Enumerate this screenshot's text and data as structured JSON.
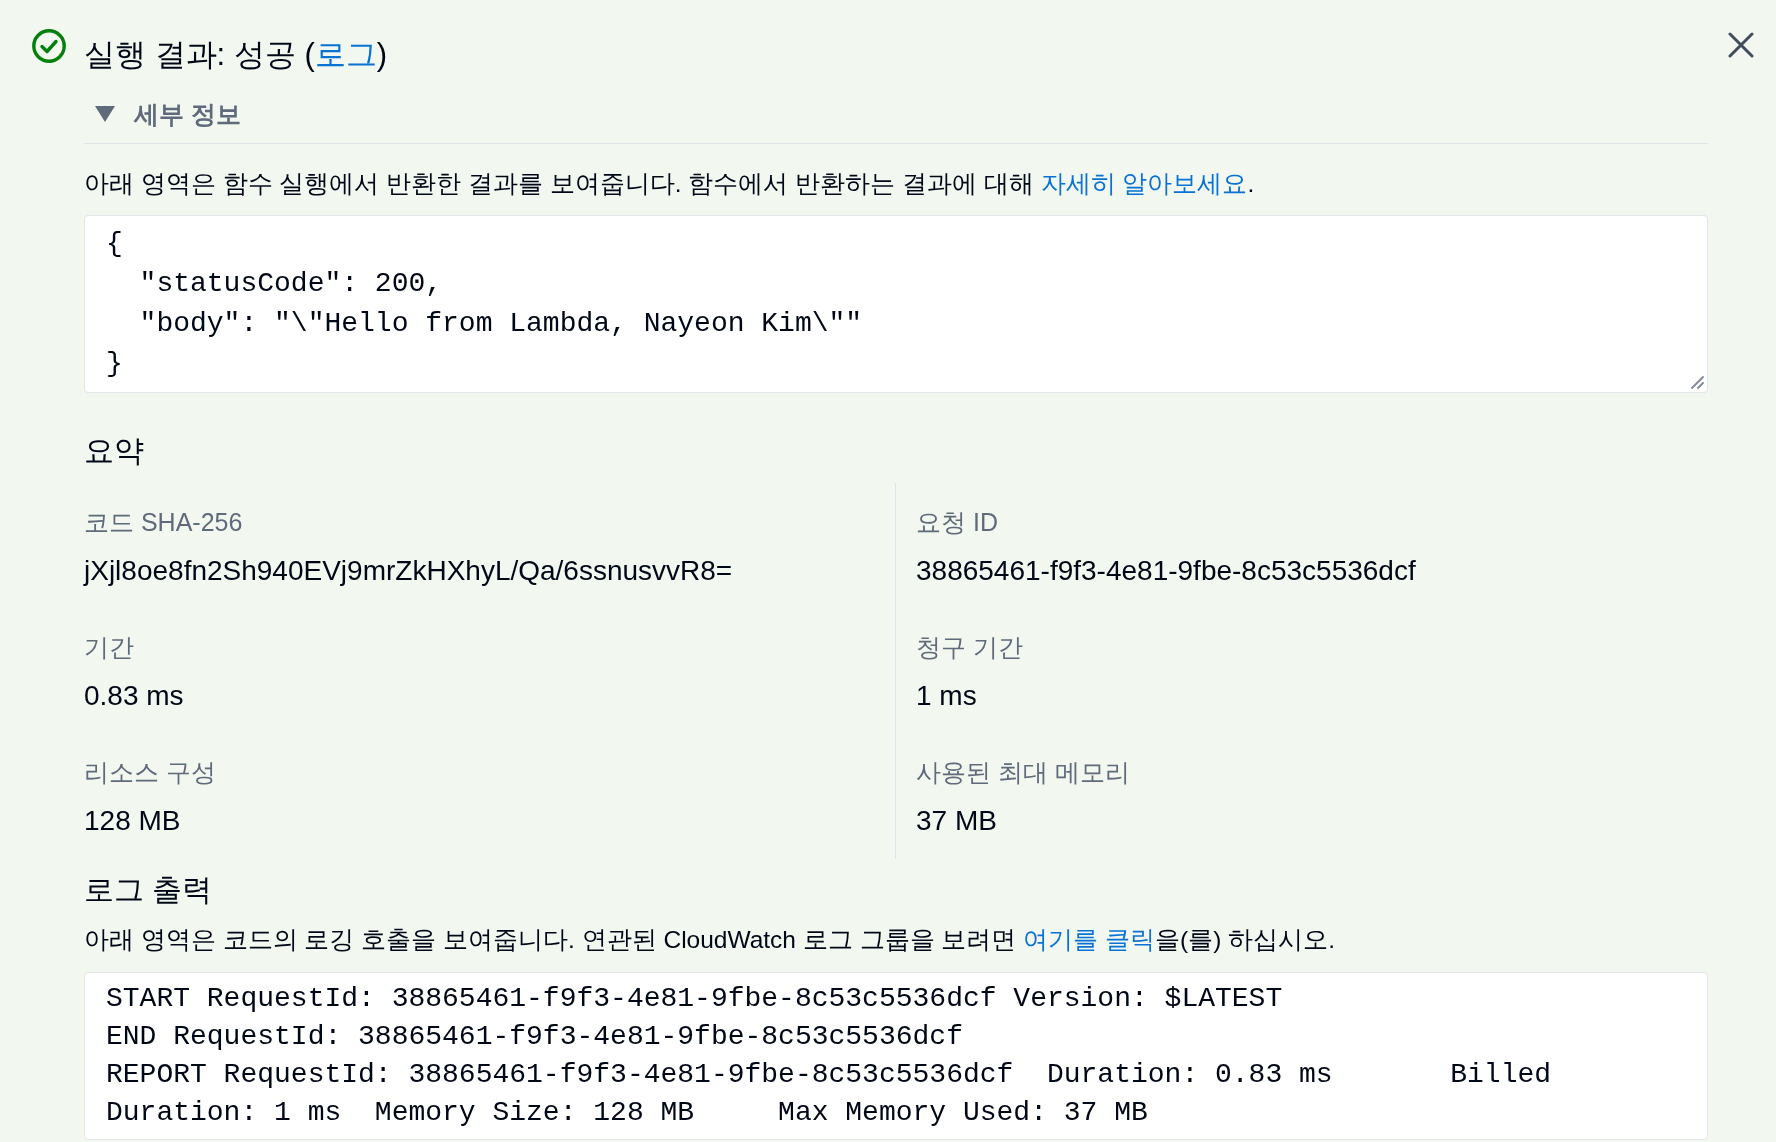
{
  "title": {
    "text": "실행 결과: 성공 (",
    "link": "로그",
    "after": ")"
  },
  "details": {
    "label": "세부 정보",
    "expanded": true
  },
  "description": {
    "before": "아래 영역은 함수 실행에서 반환한 결과를 보여줍니다. 함수에서 반환하는 결과에 대해 ",
    "link": "자세히 알아보세요",
    "after": "."
  },
  "response": {
    "lines": [
      "{",
      "  \"statusCode\": 200,",
      "  \"body\": \"\\\"Hello from Lambda, Nayeon Kim\\\"\"",
      "}"
    ]
  },
  "summary": {
    "title": "요약",
    "columns": [
      {
        "items": [
          {
            "label": "코드 SHA-256",
            "value": "jXjl8oe8fn2Sh940EVj9mrZkHXhyL/Qa/6ssnusvvR8="
          },
          {
            "label": "기간",
            "value": "0.83 ms"
          },
          {
            "label": "리소스 구성",
            "value": "128 MB"
          }
        ]
      },
      {
        "items": [
          {
            "label": "요청 ID",
            "value": "38865461-f9f3-4e81-9fbe-8c53c5536dcf"
          },
          {
            "label": "청구 기간",
            "value": "1 ms"
          },
          {
            "label": "사용된 최대 메모리",
            "value": "37 MB"
          }
        ]
      }
    ]
  },
  "log_output": {
    "title": "로그 출력",
    "description": {
      "before": "아래 영역은 코드의 로깅 호출을 보여줍니다. 연관된 CloudWatch 로그 그룹을 보려면 ",
      "link": "여기를 클릭",
      "after": "을(를) 하십시오."
    },
    "lines": [
      "START RequestId: 38865461-f9f3-4e81-9fbe-8c53c5536dcf Version: $LATEST",
      "END RequestId: 38865461-f9f3-4e81-9fbe-8c53c5536dcf",
      "REPORT RequestId: 38865461-f9f3-4e81-9fbe-8c53c5536dcf  Duration: 0.83 ms       Billed",
      "Duration: 1 ms  Memory Size: 128 MB     Max Memory Used: 37 MB"
    ]
  }
}
